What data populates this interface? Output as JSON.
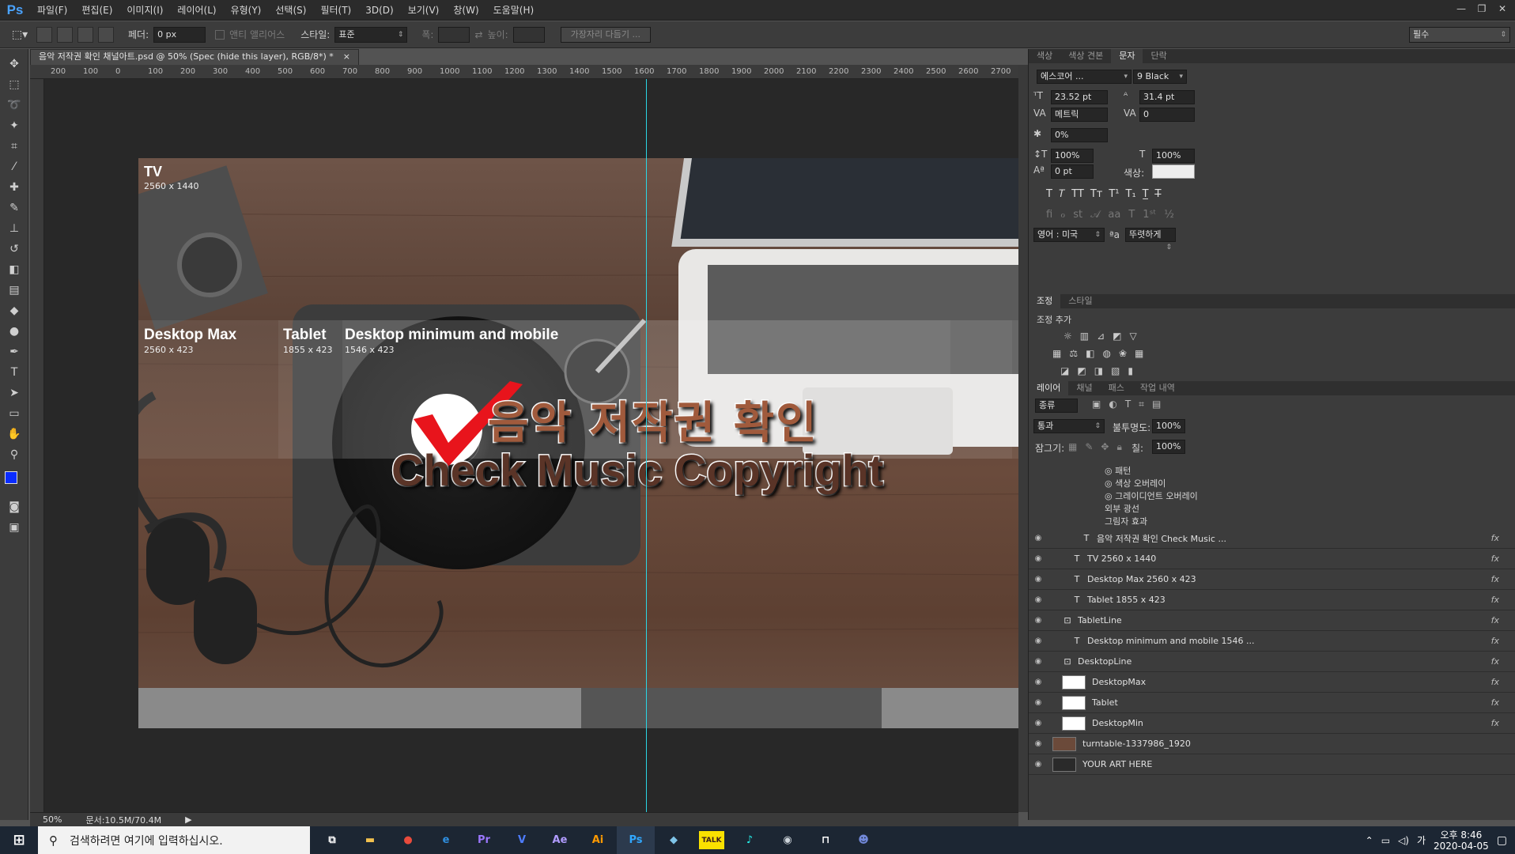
{
  "app": {
    "logo": "Ps"
  },
  "menu": [
    "파일(F)",
    "편집(E)",
    "이미지(I)",
    "레이어(L)",
    "유형(Y)",
    "선택(S)",
    "필터(T)",
    "3D(D)",
    "보기(V)",
    "창(W)",
    "도움말(H)"
  ],
  "options": {
    "feather_label": "페더:",
    "feather_value": "0 px",
    "antialias_label": "앤티 앨리어스",
    "style_label": "스타일:",
    "style_value": "표준",
    "width_label": "폭:",
    "height_label": "높이:",
    "refine_edge": "가장자리 다듬기 ...",
    "workspace": "필수"
  },
  "document": {
    "tab_title": "음악 저작권 확인 채널아트.psd @ 50% (Spec (hide this layer), RGB/8*) *",
    "close": "×",
    "zoom": "50%",
    "doc_size": "문서:10.5M/70.4M"
  },
  "ruler_ticks": [
    "200",
    "100",
    "0",
    "100",
    "200",
    "300",
    "400",
    "500",
    "600",
    "700",
    "800",
    "900",
    "1000",
    "1100",
    "1200",
    "1300",
    "1400",
    "1500",
    "1600",
    "1700",
    "1800",
    "1900",
    "2000",
    "2100",
    "2200",
    "2300",
    "2400",
    "2500",
    "2600",
    "2700"
  ],
  "artwork": {
    "tv_title": "TV",
    "tv_size": "2560 x 1440",
    "dmax_title": "Desktop Max",
    "dmax_size": "2560 x 423",
    "tablet_title": "Tablet",
    "tablet_size": "1855 x 423",
    "dmin_title": "Desktop minimum and mobile",
    "dmin_size": "1546 x 423",
    "headline_ko": "음악 저작권 확인",
    "headline_en": "Check Music Copyright"
  },
  "char_panel": {
    "tabs": [
      "색상",
      "색상 견본",
      "문자",
      "단락"
    ],
    "active_tab": "문자",
    "font_family": "에스코어 ...",
    "font_weight": "9 Black",
    "font_size": "23.52 pt",
    "leading": "31.4 pt",
    "kerning": "메트릭",
    "tracking": "0",
    "tsume": "0%",
    "vscale": "100%",
    "hscale": "100%",
    "baseline": "0 pt",
    "color_label": "색상:",
    "language": "영어 : 미국",
    "aa_label": "ªa",
    "antialias": "뚜렷하게"
  },
  "adjust_panel": {
    "tabs": [
      "조정",
      "스타일"
    ],
    "title": "조정 추가"
  },
  "layers_panel": {
    "tabs": [
      "레이어",
      "채널",
      "패스",
      "작업 내역"
    ],
    "filter": "종류",
    "blend": "통과",
    "opacity_label": "불투명도:",
    "opacity": "100%",
    "lock_label": "잠그기:",
    "fill_label": "칠:",
    "fill": "100%",
    "effects": [
      "패턴",
      "색상 오버레이",
      "그레이디언트 오버레이",
      "외부 광선",
      "그림자 효과"
    ],
    "layers": [
      {
        "name": "음악 저작권 확인  Check Music ...",
        "kind": "text",
        "indent": 3
      },
      {
        "name": "TV 2560 x 1440",
        "kind": "text",
        "indent": 2
      },
      {
        "name": "Desktop Max 2560 x 423",
        "kind": "text",
        "indent": 2
      },
      {
        "name": "Tablet 1855 x 423",
        "kind": "text",
        "indent": 2
      },
      {
        "name": "TabletLine",
        "kind": "smart",
        "indent": 1
      },
      {
        "name": "Desktop minimum and mobile 1546 ...",
        "kind": "text",
        "indent": 2
      },
      {
        "name": "DesktopLine",
        "kind": "smart",
        "indent": 1
      },
      {
        "name": "DesktopMax",
        "kind": "thumb",
        "indent": 1
      },
      {
        "name": "Tablet",
        "kind": "thumb",
        "indent": 1
      },
      {
        "name": "DesktopMin",
        "kind": "thumb",
        "indent": 1
      },
      {
        "name": "turntable-1337986_1920",
        "kind": "photo",
        "indent": 0
      },
      {
        "name": "YOUR ART HERE",
        "kind": "dark",
        "indent": 0
      }
    ],
    "fx": "fx"
  },
  "taskbar": {
    "search_placeholder": "검색하려면 여기에 입력하십시오.",
    "time": "오후 8:46",
    "date": "2020-04-05",
    "ime": "가",
    "apps": [
      {
        "icon": "file-explorer-icon",
        "glyph": "▬",
        "color": "#f2c14e"
      },
      {
        "icon": "chrome-icon",
        "glyph": "●",
        "color": "#e94b3c"
      },
      {
        "icon": "edge-icon",
        "glyph": "e",
        "color": "#2f8fe0"
      },
      {
        "icon": "premiere-icon",
        "glyph": "Pr",
        "color": "#9b77ff"
      },
      {
        "icon": "vegas-icon",
        "glyph": "V",
        "color": "#4e7dff"
      },
      {
        "icon": "after-effects-icon",
        "glyph": "Ae",
        "color": "#b19cff"
      },
      {
        "icon": "illustrator-icon",
        "glyph": "Ai",
        "color": "#ff9a00"
      },
      {
        "icon": "photoshop-icon",
        "glyph": "Ps",
        "color": "#31a8ff"
      },
      {
        "icon": "notepad-icon",
        "glyph": "◆",
        "color": "#7fc4e8"
      },
      {
        "icon": "kakaotalk-icon",
        "glyph": "TALK",
        "color": "#3a1d1d"
      },
      {
        "icon": "tiktok-icon",
        "glyph": "♪",
        "color": "#25f4ee"
      },
      {
        "icon": "obs-icon",
        "glyph": "◉",
        "color": "#cfd6dc"
      },
      {
        "icon": "pinned-app-icon",
        "glyph": "⊓",
        "color": "#ffffff"
      },
      {
        "icon": "discord-icon",
        "glyph": "☻",
        "color": "#7289da"
      }
    ]
  },
  "colors": {
    "guide": "#2ad7e6",
    "headline_ko": "#a05a3c",
    "headline_en": "#5a3427",
    "check": "#e8141c"
  }
}
